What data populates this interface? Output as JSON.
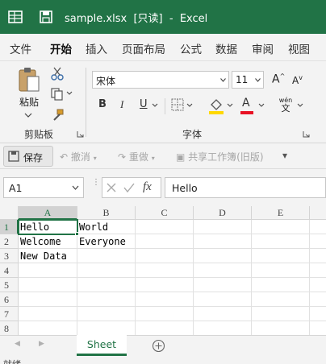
{
  "titlebar": {
    "filename": "sample.xlsx",
    "mode": "[只读]",
    "separator": "-",
    "app": "Excel"
  },
  "tabs": [
    "文件",
    "开始",
    "插入",
    "页面布局",
    "公式",
    "数据",
    "审阅",
    "视图"
  ],
  "active_tab": "开始",
  "ribbon": {
    "paste_label": "粘贴",
    "clipboard_label": "剪贴板",
    "font_label": "字体",
    "font_name": "宋体",
    "font_size": "11",
    "bold": "B",
    "italic": "I",
    "underline": "U",
    "grow_font": "A",
    "shrink_font": "A",
    "font_color": "A",
    "phonetic_top": "wén",
    "phonetic_bottom": "文"
  },
  "qat": {
    "save": "保存",
    "undo": "撤消",
    "redo": "重做",
    "share": "共享工作簿(旧版)"
  },
  "formula_bar": {
    "name_box": "A1",
    "fx": "fx",
    "value": "Hello"
  },
  "grid": {
    "columns": [
      "A",
      "B",
      "C",
      "D",
      "E"
    ],
    "rows": [
      "1",
      "2",
      "3",
      "4",
      "5",
      "6",
      "7",
      "8"
    ],
    "cells": {
      "A1": "Hello",
      "B1": "World",
      "A2": "Welcome",
      "B2": "Everyone",
      "A3": "New Data"
    },
    "active_cell": "A1"
  },
  "sheets": [
    "Sheet"
  ],
  "status": "就绪",
  "colors": {
    "brand": "#217346",
    "ribbon_bg": "#f3f3f3",
    "underline_red": "#e81123",
    "highlight_yellow": "#ffd800"
  }
}
